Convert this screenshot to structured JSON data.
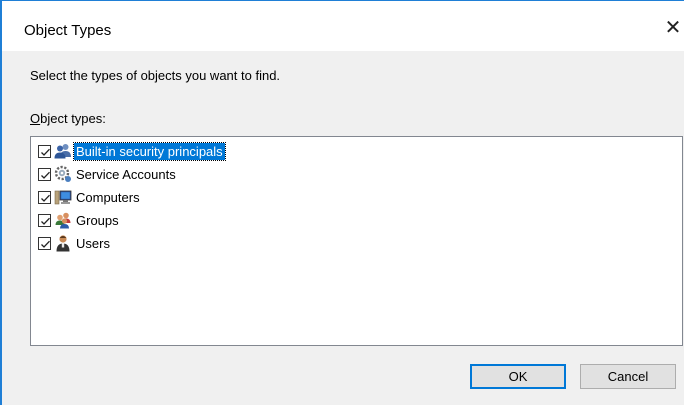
{
  "window": {
    "title": "Object Types",
    "close_glyph": "✕"
  },
  "instruction": "Select the types of objects you want to find.",
  "list": {
    "label_accel": "O",
    "label_rest": "bject types:",
    "items": [
      {
        "label": "Built-in security principals",
        "checked": true,
        "selected": true,
        "icon": "security-principals-icon"
      },
      {
        "label": "Service Accounts",
        "checked": true,
        "selected": false,
        "icon": "service-accounts-icon"
      },
      {
        "label": "Computers",
        "checked": true,
        "selected": false,
        "icon": "computers-icon"
      },
      {
        "label": "Groups",
        "checked": true,
        "selected": false,
        "icon": "groups-icon"
      },
      {
        "label": "Users",
        "checked": true,
        "selected": false,
        "icon": "user-icon"
      }
    ]
  },
  "buttons": {
    "ok": "OK",
    "cancel": "Cancel"
  },
  "colors": {
    "accent": "#0078d7",
    "window_border": "#1f7fd6"
  }
}
